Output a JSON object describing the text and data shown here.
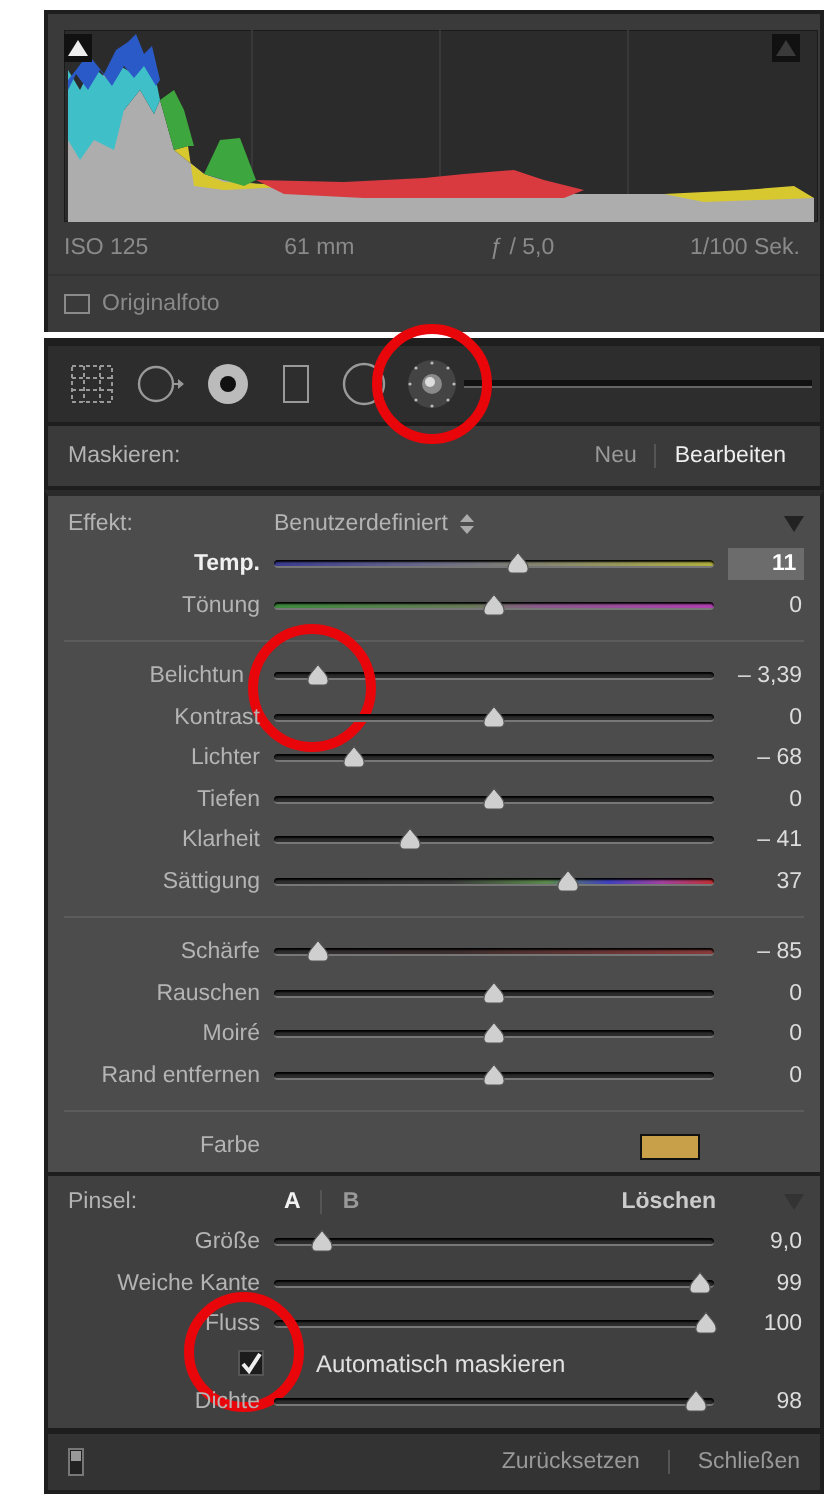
{
  "histogram": {
    "shadow_clipping": true,
    "highlight_clipping": false,
    "exif": [
      "ISO 125",
      "61 mm",
      "ƒ / 5,0",
      "1/100 Sek."
    ],
    "original_photo": {
      "label": "Originalfoto",
      "checked": false
    }
  },
  "tools": [
    {
      "kind": "crop",
      "selected": false,
      "circled": false
    },
    {
      "kind": "spot",
      "selected": false,
      "circled": false
    },
    {
      "kind": "redeye",
      "selected": false,
      "circled": false
    },
    {
      "kind": "graduated",
      "selected": false,
      "circled": false
    },
    {
      "kind": "radial",
      "selected": false,
      "circled": false
    },
    {
      "kind": "brush",
      "selected": true,
      "circled": true
    }
  ],
  "mask": {
    "label": "Maskieren:",
    "modes": [
      {
        "label": "Neu",
        "selected": false
      },
      {
        "label": "Bearbeiten",
        "selected": true
      }
    ]
  },
  "effect": {
    "label": "Effekt:",
    "preset": "Benutzerdefiniert"
  },
  "slider_groups": [
    [
      {
        "label": "Temp.",
        "kind": "temp",
        "level": 0.555,
        "value": "11",
        "active": true,
        "circled": false
      },
      {
        "label": "Tönung",
        "kind": "tint",
        "level": 0.5,
        "value": "0",
        "active": false,
        "circled": false
      }
    ],
    [
      {
        "label": "Belichtun",
        "kind": "plain",
        "level": 0.1,
        "value": "– 3,39",
        "active": false,
        "circled": true
      },
      {
        "label": "Kontrast",
        "kind": "plain",
        "level": 0.5,
        "value": "0",
        "active": false,
        "circled": false
      },
      {
        "label": "Lichter",
        "kind": "plain",
        "level": 0.18,
        "value": "– 68",
        "active": false,
        "circled": false
      },
      {
        "label": "Tiefen",
        "kind": "plain",
        "level": 0.5,
        "value": "0",
        "active": false,
        "circled": false
      },
      {
        "label": "Klarheit",
        "kind": "plain",
        "level": 0.31,
        "value": "– 41",
        "active": false,
        "circled": false
      },
      {
        "label": "Sättigung",
        "kind": "saturation",
        "level": 0.67,
        "value": "37",
        "active": false,
        "circled": false
      }
    ],
    [
      {
        "label": "Schärfe",
        "kind": "sharpness",
        "level": 0.1,
        "value": "– 85",
        "active": false,
        "circled": false
      },
      {
        "label": "Rauschen",
        "kind": "plain",
        "level": 0.5,
        "value": "0",
        "active": false,
        "circled": false
      },
      {
        "label": "Moiré",
        "kind": "plain",
        "level": 0.5,
        "value": "0",
        "active": false,
        "circled": false
      },
      {
        "label": "Rand entfernen",
        "kind": "plain",
        "level": 0.5,
        "value": "0",
        "active": false,
        "circled": false
      }
    ]
  ],
  "color": {
    "label": "Farbe",
    "color": "#c9a04a"
  },
  "brush": {
    "label": "Pinsel:",
    "presets": [
      {
        "label": "A",
        "selected": true
      },
      {
        "label": "B",
        "selected": false
      }
    ],
    "erase": "Löschen",
    "rows": [
      {
        "kind": "slider",
        "label": "Größe",
        "level": 0.11,
        "value": "9,0",
        "active": false,
        "circled": false
      },
      {
        "kind": "slider",
        "label": "Weiche Kante",
        "level": 0.97,
        "value": "99",
        "active": false,
        "circled": false
      },
      {
        "kind": "slider",
        "label": "Fluss",
        "level": 0.98,
        "value": "100",
        "active": false,
        "circled": false
      },
      {
        "kind": "checkbox",
        "label": "Automatisch maskieren",
        "checked": true,
        "circled": true
      },
      {
        "kind": "slider",
        "label": "Dichte",
        "level": 0.96,
        "value": "98",
        "active": false,
        "circled": false
      }
    ]
  },
  "footer": {
    "reset": "Zurücksetzen",
    "close": "Schließen"
  }
}
